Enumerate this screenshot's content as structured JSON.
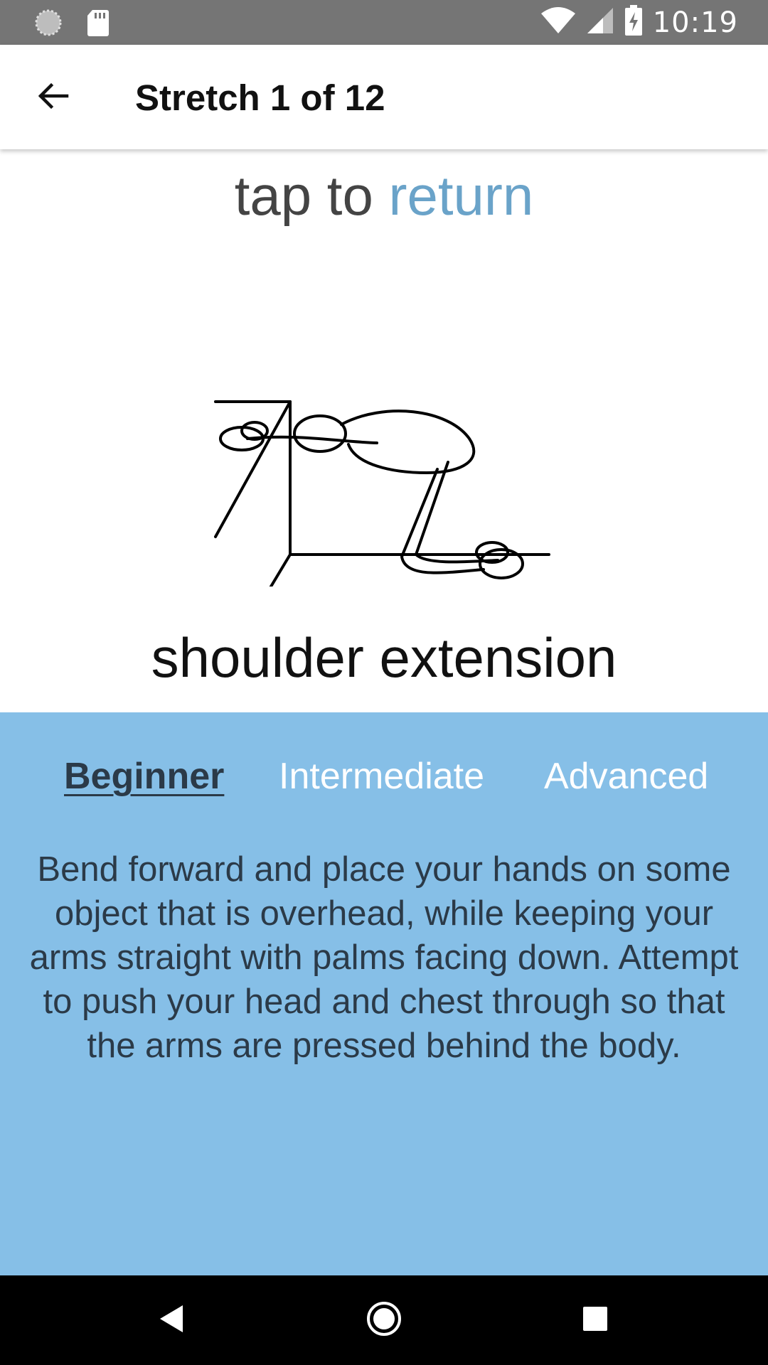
{
  "status_bar": {
    "time": "10:19",
    "left_icons": [
      "circle-indicator-icon",
      "sd-card-icon"
    ],
    "right_icons": [
      "wifi-icon",
      "signal-icon",
      "battery-charging-icon"
    ]
  },
  "app_bar": {
    "title": "Stretch 1 of 12",
    "back_icon": "arrow-left-icon"
  },
  "content": {
    "tap_prefix": "tap to ",
    "tap_link": "return",
    "stretch_name": "shoulder extension",
    "illustration_icon": "stick-figure-stretch-icon"
  },
  "panel": {
    "tabs": [
      {
        "label": "Beginner",
        "active": true
      },
      {
        "label": "Intermediate",
        "active": false
      },
      {
        "label": "Advanced",
        "active": false
      }
    ],
    "description": "Bend forward and place your hands on some object that is overhead, while keeping your arms straight with palms facing down. Attempt to push your head and chest through so that the arms are pressed behind the body."
  },
  "nav_bar": {
    "icons": [
      "nav-back-icon",
      "nav-home-icon",
      "nav-recents-icon"
    ]
  },
  "colors": {
    "status_bar": "#757575",
    "panel": "#86bfe7",
    "link": "#6aa3c9",
    "text_dark": "#2b3a48"
  }
}
